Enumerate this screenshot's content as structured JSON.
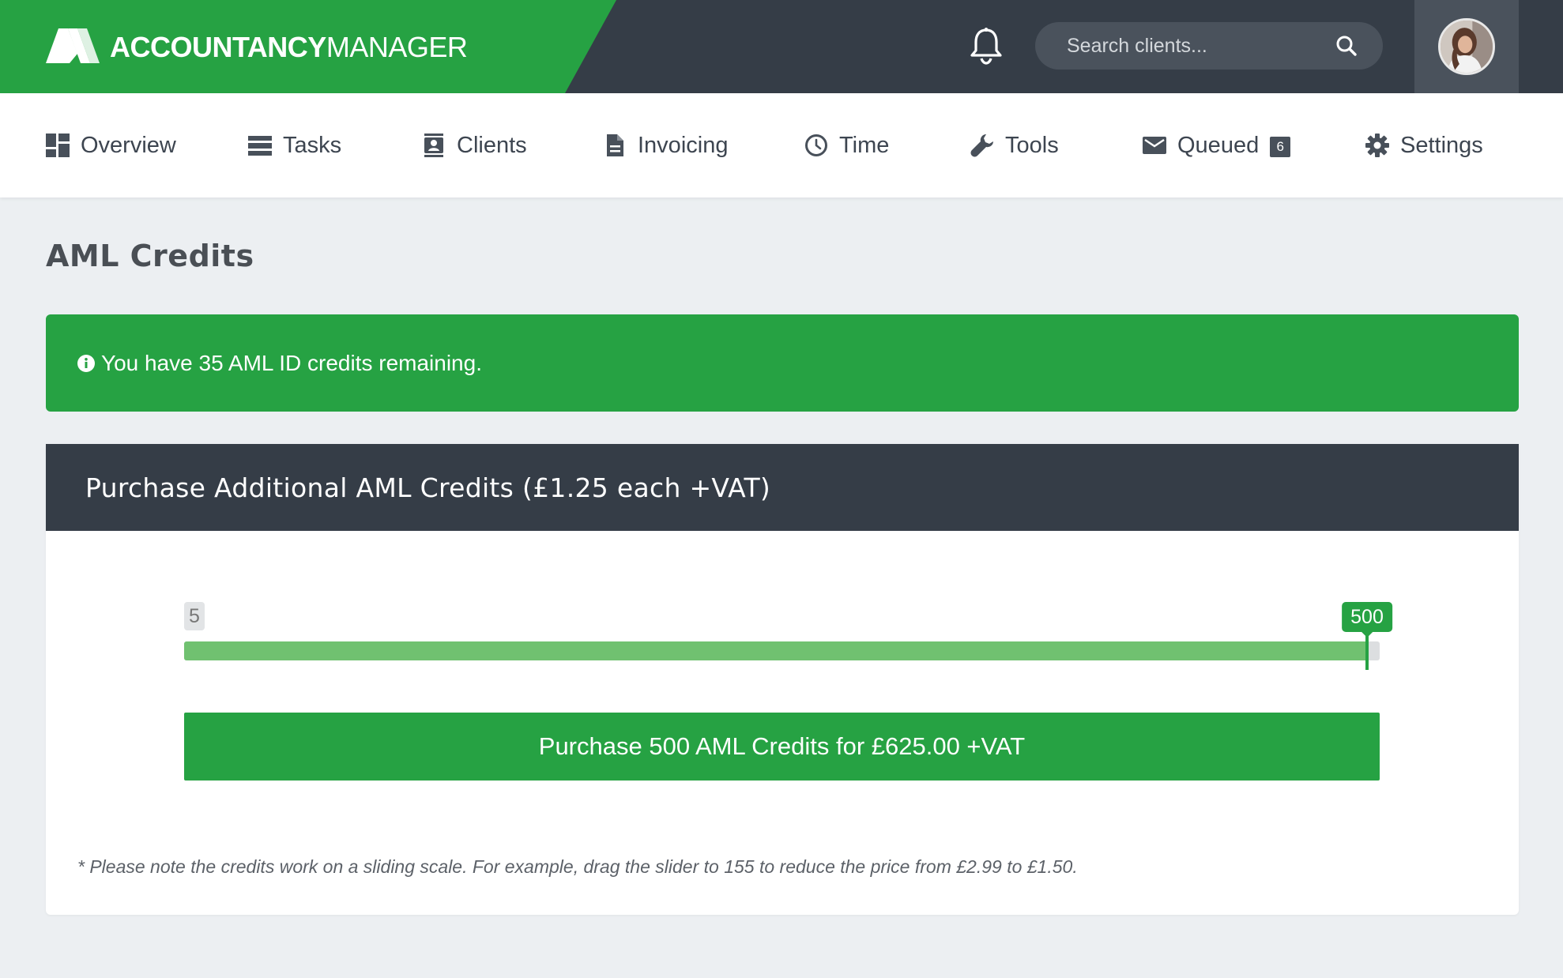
{
  "brand": {
    "name_bold": "ACCOUNTANCY",
    "name_light": "MANAGER"
  },
  "header": {
    "search_placeholder": "Search clients...",
    "icons": [
      "bell-icon",
      "search-icon",
      "avatar"
    ]
  },
  "nav": {
    "items": [
      {
        "label": "Overview",
        "icon": "dashboard-icon"
      },
      {
        "label": "Tasks",
        "icon": "tasks-icon"
      },
      {
        "label": "Clients",
        "icon": "contacts-icon"
      },
      {
        "label": "Invoicing",
        "icon": "document-icon"
      },
      {
        "label": "Time",
        "icon": "clock-icon"
      },
      {
        "label": "Tools",
        "icon": "wrench-icon"
      },
      {
        "label": "Queued",
        "icon": "mail-icon",
        "badge": "6"
      },
      {
        "label": "Settings",
        "icon": "gear-icon"
      }
    ]
  },
  "page": {
    "title": "AML Credits",
    "alert": "You have 35 AML ID credits remaining."
  },
  "purchase": {
    "header": "Purchase Additional AML Credits (£1.25 each +VAT)",
    "slider": {
      "min": 5,
      "max": 500,
      "value": 500,
      "min_label": "5",
      "value_label": "500"
    },
    "button_label": "Purchase 500 AML Credits for £625.00 +VAT",
    "footnote": "* Please note the credits work on a sliding scale. For example, drag the slider to 155 to reduce the price from £2.99 to £1.50."
  },
  "colors": {
    "brand_green": "#26a243",
    "dark": "#353d47",
    "slider_fill": "#70c170"
  }
}
